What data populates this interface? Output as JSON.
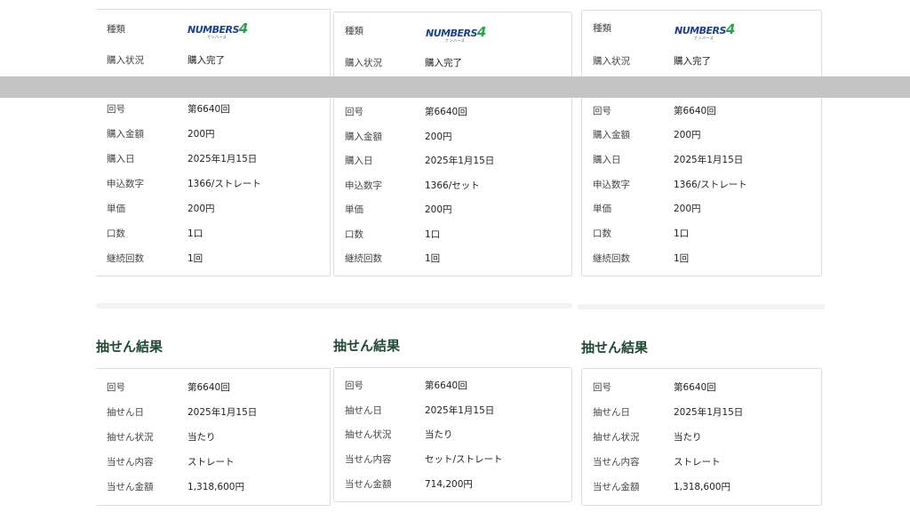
{
  "purchase_labels": [
    "種類",
    "購入状況",
    "回号",
    "購入金額",
    "購入日",
    "申込数字",
    "単価",
    "口数",
    "継続回数"
  ],
  "purchases": [
    {
      "logo_main": "NUMBERS",
      "logo_four": "4",
      "logo_sub": "ナンバーズ",
      "status": "購入完了",
      "round": "第6640回",
      "amount": "200円",
      "date": "2025年1月15日",
      "numbers": "1366/ストレート",
      "unit_price": "200円",
      "units": "1口",
      "repeat": "1回"
    },
    {
      "logo_main": "NUMBERS",
      "logo_four": "4",
      "logo_sub": "ナンバーズ",
      "status": "購入完了",
      "round": "第6640回",
      "amount": "200円",
      "date": "2025年1月15日",
      "numbers": "1366/セット",
      "unit_price": "200円",
      "units": "1口",
      "repeat": "1回"
    },
    {
      "logo_main": "NUMBERS",
      "logo_four": "4",
      "logo_sub": "ナンバーズ",
      "status": "購入完了",
      "round": "第6640回",
      "amount": "200円",
      "date": "2025年1月15日",
      "numbers": "1366/ストレート",
      "unit_price": "200円",
      "units": "1口",
      "repeat": "1回"
    }
  ],
  "result_heading": "抽せん結果",
  "result_labels": [
    "回号",
    "抽せん日",
    "抽せん状況",
    "当せん内容",
    "当せん金額"
  ],
  "results": [
    {
      "round": "第6640回",
      "draw_date": "2025年1月15日",
      "draw_status": "当たり",
      "prize_type": "ストレート",
      "prize_amount": "1,318,600円"
    },
    {
      "round": "第6640回",
      "draw_date": "2025年1月15日",
      "draw_status": "当たり",
      "prize_type": "セット/ストレート",
      "prize_amount": "714,200円"
    },
    {
      "round": "第6640回",
      "draw_date": "2025年1月15日",
      "draw_status": "当たり",
      "prize_type": "ストレート",
      "prize_amount": "1,318,600円"
    }
  ],
  "colors": {
    "heading": "#1f4a33",
    "logo_blue": "#1a3f9a",
    "logo_green": "#2aa24a",
    "overlay": "#c4c4c4"
  }
}
